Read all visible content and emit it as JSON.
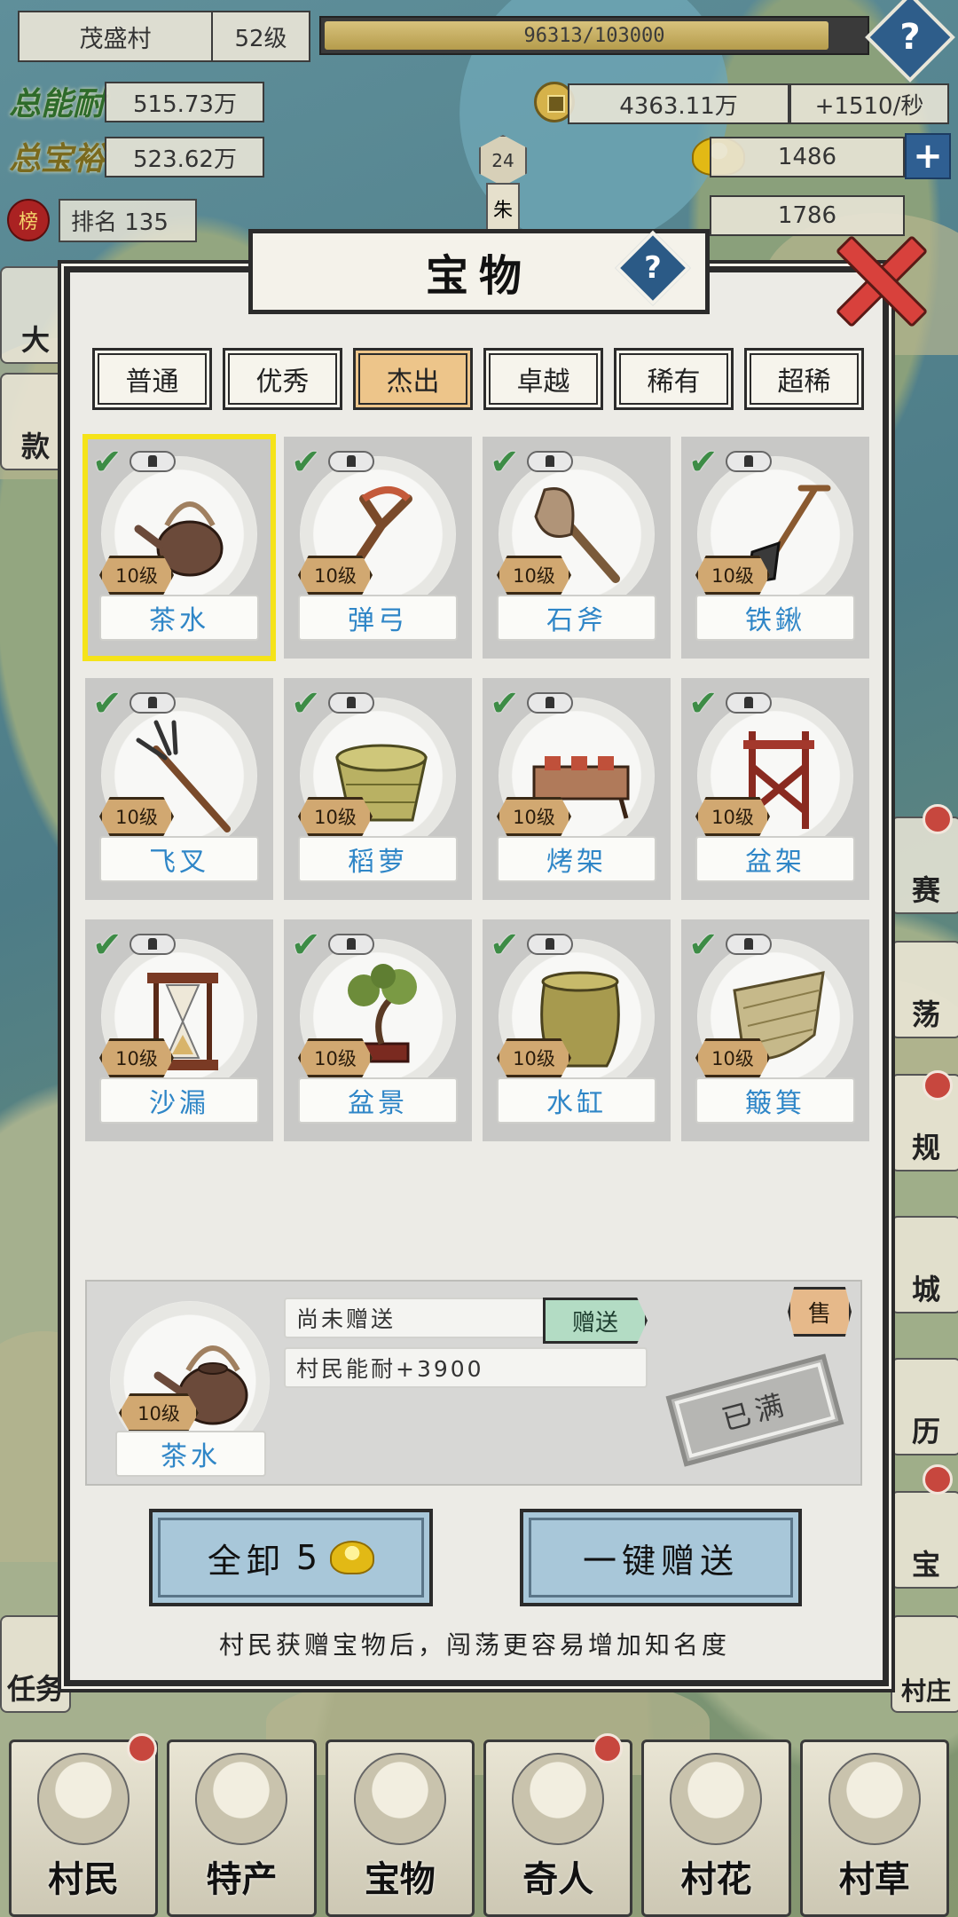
{
  "header": {
    "village_name": "茂盛村",
    "village_level": "52级",
    "progress_text": "96313/103000",
    "progress_fraction": 0.935,
    "help_icon": "question-icon"
  },
  "stats": {
    "total_ability_label": "总能耐",
    "total_ability_value": "515.73万",
    "total_wealth_label": "总宝裕",
    "total_wealth_value": "523.62万",
    "rank_badge": "榜",
    "rank_text": "排名 135",
    "coins_value": "4363.11万",
    "coins_rate": "+1510/秒",
    "ingots_value": "1486",
    "third_value": "1786",
    "level_hex": "24",
    "level_hex_label": "朱"
  },
  "side_left": [
    {
      "label": "大"
    },
    {
      "label": "款"
    },
    {
      "label": "任务"
    }
  ],
  "side_right": [
    {
      "label": "赛",
      "dot": true
    },
    {
      "label": "荡",
      "dot": false
    },
    {
      "label": "规",
      "dot": true
    },
    {
      "label": "城",
      "dot": false
    },
    {
      "label": "历",
      "dot": false
    },
    {
      "label": "宝",
      "dot": true
    },
    {
      "label": "村庄",
      "dot": false
    }
  ],
  "modal": {
    "title": "宝物",
    "tabs": [
      "普通",
      "优秀",
      "杰出",
      "卓越",
      "稀有",
      "超稀"
    ],
    "active_tab": 2,
    "items": [
      {
        "name": "茶水",
        "level": "10级",
        "icon": "teapot-icon"
      },
      {
        "name": "弹弓",
        "level": "10级",
        "icon": "slingshot-icon"
      },
      {
        "name": "石斧",
        "level": "10级",
        "icon": "stone-axe-icon"
      },
      {
        "name": "铁鍬",
        "level": "10级",
        "icon": "shovel-icon"
      },
      {
        "name": "飞叉",
        "level": "10级",
        "icon": "trident-icon"
      },
      {
        "name": "稻萝",
        "level": "10级",
        "icon": "basket-icon"
      },
      {
        "name": "烤架",
        "level": "10级",
        "icon": "grill-icon"
      },
      {
        "name": "盆架",
        "level": "10级",
        "icon": "basin-stand-icon"
      },
      {
        "name": "沙漏",
        "level": "10级",
        "icon": "hourglass-icon"
      },
      {
        "name": "盆景",
        "level": "10级",
        "icon": "bonsai-icon"
      },
      {
        "name": "水缸",
        "level": "10级",
        "icon": "water-jar-icon"
      },
      {
        "name": "簸箕",
        "level": "10级",
        "icon": "dustpan-icon"
      }
    ],
    "detail": {
      "name": "茶水",
      "level": "10级",
      "status": "尚未赠送",
      "gift_label": "赠送",
      "bonus": "村民能耐+3900",
      "sell_label": "售",
      "full_stamp": "已满"
    },
    "unload_label": "全卸",
    "unload_cost": "5",
    "gift_all_label": "一键赠送",
    "tip": "村民获赠宝物后，闯荡更容易增加知名度"
  },
  "bottom_nav": [
    "村民",
    "特产",
    "宝物",
    "奇人",
    "村花",
    "村草"
  ],
  "bottom_nav_dots": [
    false,
    true,
    false,
    true,
    false,
    false
  ]
}
